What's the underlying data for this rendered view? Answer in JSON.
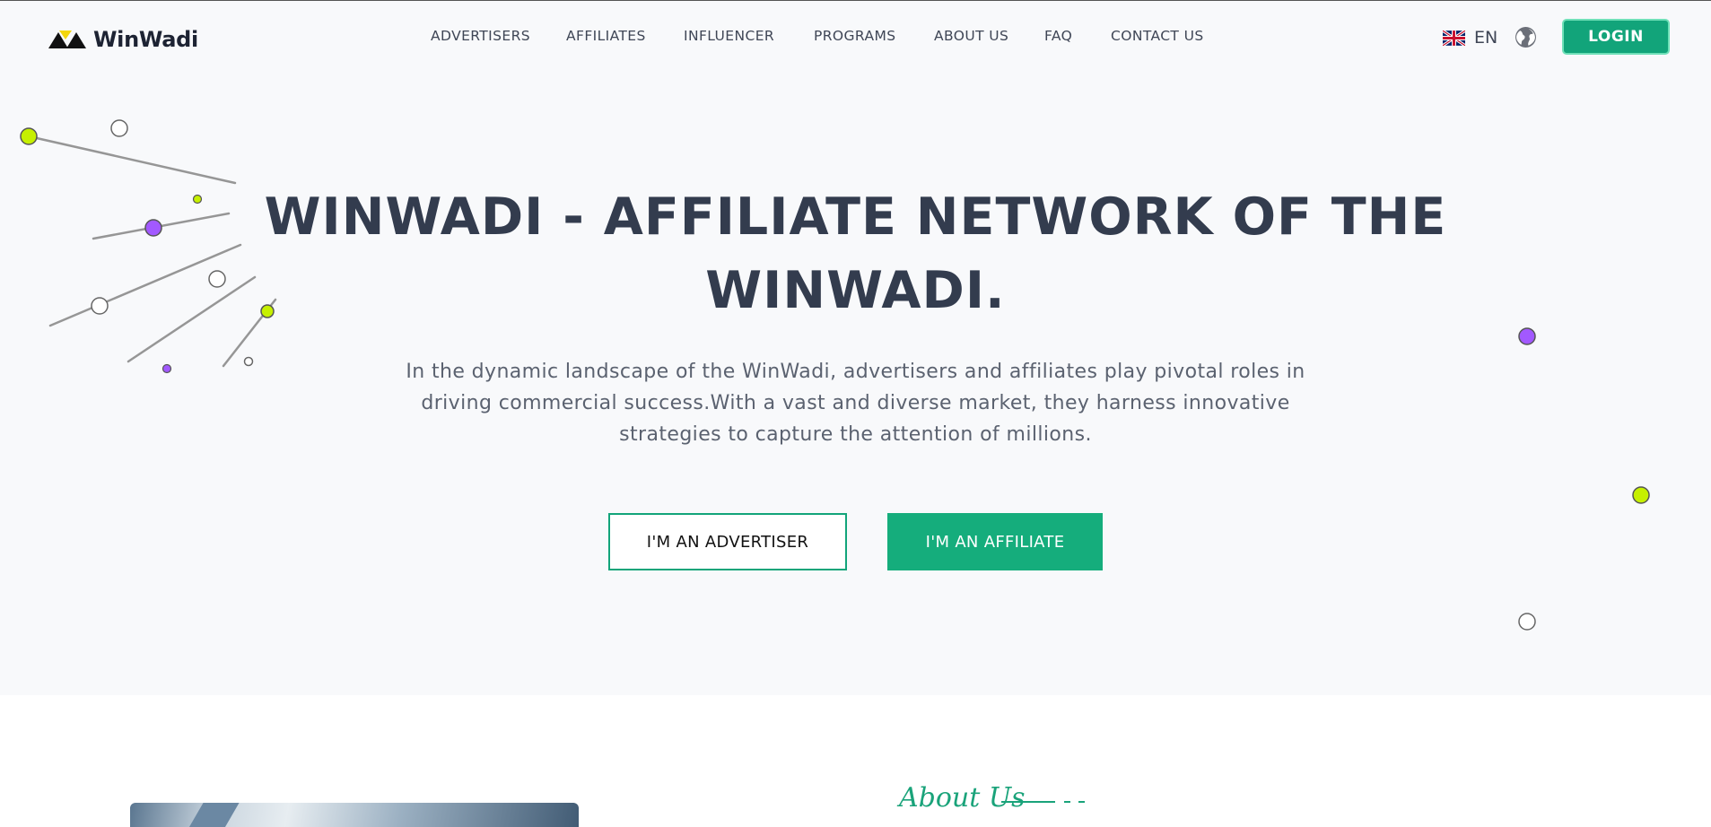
{
  "brand": {
    "name": "WinWadi",
    "colors": {
      "primary_green": "#12a47a",
      "dark_text": "#333c4e",
      "lime": "#c6f000",
      "purple": "#a259ff"
    }
  },
  "nav": {
    "items": [
      {
        "label": "ADVERTISERS"
      },
      {
        "label": "AFFILIATES"
      },
      {
        "label": "INFLUENCER"
      },
      {
        "label": "PROGRAMS"
      },
      {
        "label": "ABOUT US"
      },
      {
        "label": "FAQ"
      },
      {
        "label": "CONTACT US"
      }
    ]
  },
  "language": {
    "code": "EN",
    "flag_icon": "uk-flag-icon",
    "globe_icon": "globe-icon"
  },
  "login": {
    "label": "LOGIN"
  },
  "hero": {
    "title_line1": "WINWADI - AFFILIATE NETWORK OF THE",
    "title_line2": "WINWADI.",
    "subtitle_line1": "In the dynamic landscape of the WinWadi, advertisers and affiliates play pivotal roles in",
    "subtitle_line2": "driving commercial success.With a vast and diverse market, they harness innovative",
    "subtitle_line3": "strategies to capture the attention of millions.",
    "advertiser_button": "I'M AN ADVERTISER",
    "affiliate_button": "I'M AN AFFILIATE"
  },
  "about": {
    "label": "About Us"
  }
}
